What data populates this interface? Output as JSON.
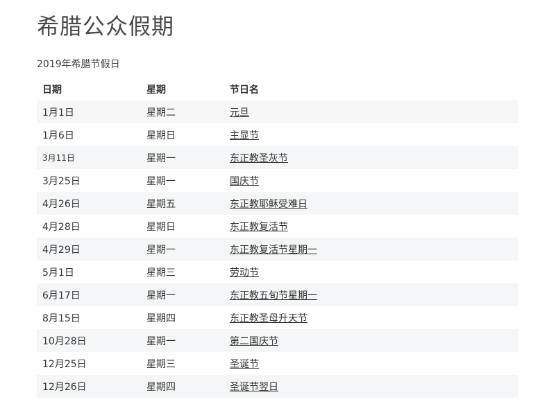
{
  "page": {
    "title": "希腊公众假期",
    "caption": "2019年希腊节假日"
  },
  "table": {
    "headers": {
      "date": "日期",
      "weekday": "星期",
      "holiday": "节日名"
    },
    "rows": [
      {
        "date": "1月1日",
        "weekday": "星期二",
        "holiday": "元旦"
      },
      {
        "date": "1月6日",
        "weekday": "星期日",
        "holiday": "主显节"
      },
      {
        "date": "3月11日",
        "weekday": "星期一",
        "holiday": "东正教圣灰节"
      },
      {
        "date": "3月25日",
        "weekday": "星期一",
        "holiday": "国庆节"
      },
      {
        "date": "4月26日",
        "weekday": "星期五",
        "holiday": "东正教耶稣受难日"
      },
      {
        "date": "4月28日",
        "weekday": "星期日",
        "holiday": "东正教复活节"
      },
      {
        "date": "4月29日",
        "weekday": "星期一",
        "holiday": "东正教复活节星期一"
      },
      {
        "date": "5月1日",
        "weekday": "星期三",
        "holiday": "劳动节"
      },
      {
        "date": "6月17日",
        "weekday": "星期一",
        "holiday": "东正教五旬节星期一"
      },
      {
        "date": "8月15日",
        "weekday": "星期四",
        "holiday": "东正教圣母升天节"
      },
      {
        "date": "10月28日",
        "weekday": "星期一",
        "holiday": "第二国庆节"
      },
      {
        "date": "12月25日",
        "weekday": "星期三",
        "holiday": "圣诞节"
      },
      {
        "date": "12月26日",
        "weekday": "星期四",
        "holiday": "圣诞节翌日"
      }
    ]
  }
}
